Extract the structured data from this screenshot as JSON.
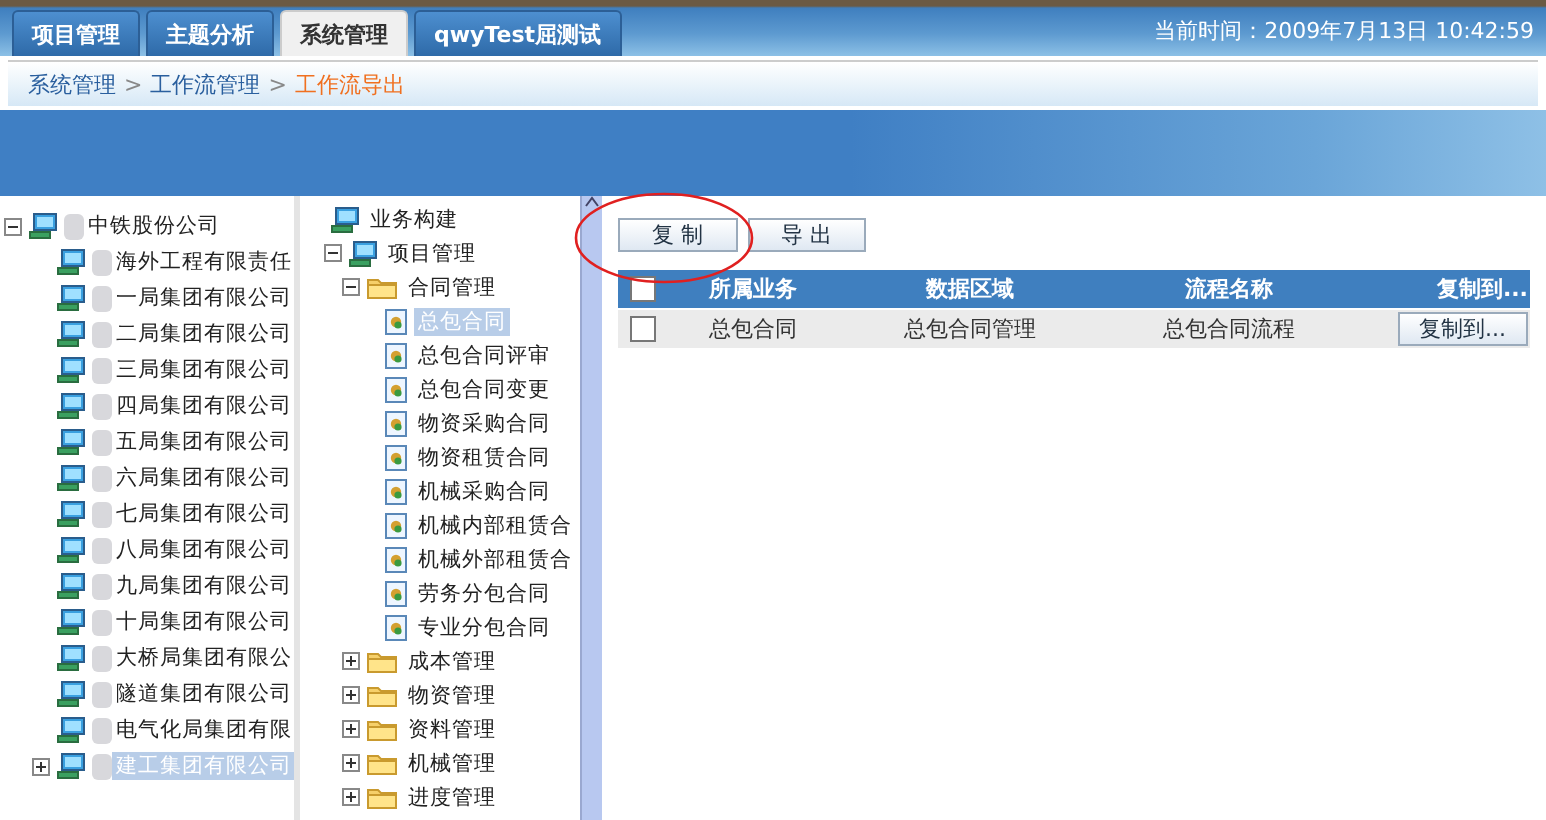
{
  "top_tabs": [
    {
      "label": "项目管理",
      "selected": false
    },
    {
      "label": "主题分析",
      "selected": false
    },
    {
      "label": "系统管理",
      "selected": true
    },
    {
      "label": "qwyTest屈测试",
      "selected": false
    }
  ],
  "current_time": "当前时间：2009年7月13日 10:42:59",
  "breadcrumb": [
    {
      "label": "系统管理",
      "current": false
    },
    {
      "label": "工作流管理",
      "current": false
    },
    {
      "label": "工作流导出",
      "current": true
    }
  ],
  "breadcrumb_separator": ">",
  "org_tree": [
    {
      "label": "中铁股份公司",
      "expanded": true,
      "redacted": true,
      "selected": false,
      "children": [
        {
          "label": "海外工程有限责任",
          "redacted": true,
          "selected": false
        },
        {
          "label": "一局集团有限公司",
          "redacted": true,
          "selected": false
        },
        {
          "label": "二局集团有限公司",
          "redacted": true,
          "selected": false
        },
        {
          "label": "三局集团有限公司",
          "redacted": true,
          "selected": false
        },
        {
          "label": "四局集团有限公司",
          "redacted": true,
          "selected": false
        },
        {
          "label": "五局集团有限公司",
          "redacted": true,
          "selected": false
        },
        {
          "label": "六局集团有限公司",
          "redacted": true,
          "selected": false
        },
        {
          "label": "七局集团有限公司",
          "redacted": true,
          "selected": false
        },
        {
          "label": "八局集团有限公司",
          "redacted": true,
          "selected": false
        },
        {
          "label": "九局集团有限公司",
          "redacted": true,
          "selected": false
        },
        {
          "label": "十局集团有限公司",
          "redacted": true,
          "selected": false
        },
        {
          "label": "大桥局集团有限公",
          "redacted": true,
          "selected": false
        },
        {
          "label": "隧道集团有限公司",
          "redacted": true,
          "selected": false
        },
        {
          "label": "电气化局集团有限",
          "redacted": true,
          "selected": false
        },
        {
          "label": "建工集团有限公司",
          "redacted": true,
          "selected": true,
          "expanded": false
        }
      ]
    }
  ],
  "business_tree": [
    {
      "label": "业务构建",
      "kind": "computer",
      "selected": false,
      "children": [
        {
          "label": "项目管理",
          "kind": "computer",
          "expanded": true,
          "selected": false,
          "children": [
            {
              "label": "合同管理",
              "kind": "folder",
              "expanded": true,
              "selected": false,
              "children": [
                {
                  "label": "总包合同",
                  "kind": "document",
                  "selected": true
                },
                {
                  "label": "总包合同评审",
                  "kind": "document",
                  "selected": false
                },
                {
                  "label": "总包合同变更",
                  "kind": "document",
                  "selected": false
                },
                {
                  "label": "物资采购合同",
                  "kind": "document",
                  "selected": false
                },
                {
                  "label": "物资租赁合同",
                  "kind": "document",
                  "selected": false
                },
                {
                  "label": "机械采购合同",
                  "kind": "document",
                  "selected": false
                },
                {
                  "label": "机械内部租赁合",
                  "kind": "document",
                  "selected": false
                },
                {
                  "label": "机械外部租赁合",
                  "kind": "document",
                  "selected": false
                },
                {
                  "label": "劳务分包合同",
                  "kind": "document",
                  "selected": false
                },
                {
                  "label": "专业分包合同",
                  "kind": "document",
                  "selected": false
                }
              ]
            },
            {
              "label": "成本管理",
              "kind": "folder",
              "expanded": false,
              "selected": false
            },
            {
              "label": "物资管理",
              "kind": "folder",
              "expanded": false,
              "selected": false
            },
            {
              "label": "资料管理",
              "kind": "folder",
              "expanded": false,
              "selected": false
            },
            {
              "label": "机械管理",
              "kind": "folder",
              "expanded": false,
              "selected": false
            },
            {
              "label": "进度管理",
              "kind": "folder",
              "expanded": false,
              "selected": false
            }
          ]
        }
      ]
    }
  ],
  "toolbar_buttons": [
    "复 制",
    "导 出"
  ],
  "table": {
    "all_checked": false,
    "columns": [
      "所属业务",
      "数据区域",
      "流程名称",
      "复制到..."
    ],
    "rows": [
      {
        "checked": false,
        "cells": [
          "总包合同",
          "总包合同管理",
          "总包合同流程"
        ],
        "button": "复制到..."
      }
    ]
  }
}
